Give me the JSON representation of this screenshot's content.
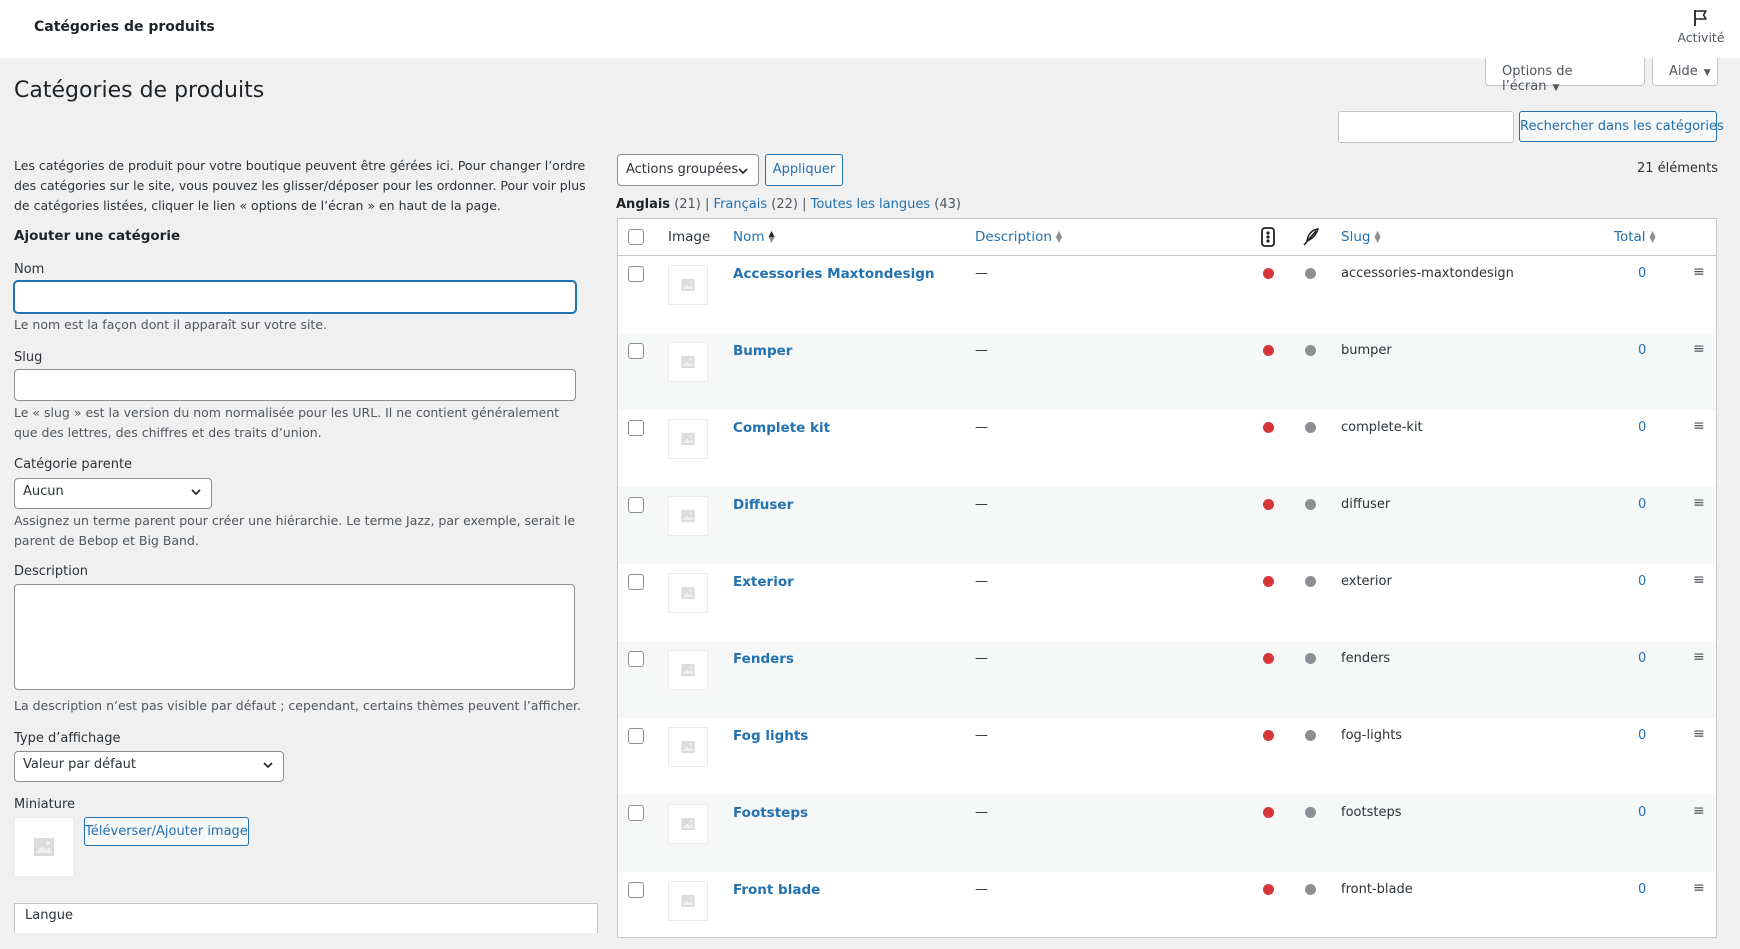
{
  "topbar": {
    "title": "Catégories de produits",
    "activity_label": "Activité"
  },
  "screen_meta": {
    "options_label": "Options de l’écran",
    "help_label": "Aide"
  },
  "page": {
    "title": "Catégories de produits"
  },
  "search": {
    "value": "",
    "button_label": "Rechercher dans les catégories"
  },
  "form": {
    "intro": "Les catégories de produit pour votre boutique peuvent être gérées ici. Pour changer l’ordre des catégories sur le site, vous pouvez les glisser/déposer pour les ordonner. Pour voir plus de catégories listées, cliquer le lien « options de l’écran » en haut de la page.",
    "heading": "Ajouter une catégorie",
    "name_label": "Nom",
    "name_value": "",
    "name_help": "Le nom est la façon dont il apparaît sur votre site.",
    "slug_label": "Slug",
    "slug_value": "",
    "slug_help": "Le « slug » est la version du nom normalisée pour les URL. Il ne contient généralement que des lettres, des chiffres et des traits d’union.",
    "parent_label": "Catégorie parente",
    "parent_value": "Aucun",
    "parent_help": "Assignez un terme parent pour créer une hiérarchie. Le terme Jazz, par exemple, serait le parent de Bebop et Big Band.",
    "description_label": "Description",
    "description_value": "",
    "description_help": "La description n’est pas visible par défaut ; cependant, certains thèmes peuvent l’afficher.",
    "display_type_label": "Type d’affichage",
    "display_type_value": "Valeur par défaut",
    "thumbnail_label": "Miniature",
    "upload_button": "Téléverser/Ajouter image",
    "language_label": "Langue"
  },
  "list": {
    "bulk_actions": "Actions groupées",
    "apply": "Appliquer",
    "count": "21 éléments",
    "filters": [
      {
        "label": "Anglais",
        "count": "(21)",
        "current": true
      },
      {
        "label": "Français",
        "count": "(22)",
        "current": false
      },
      {
        "label": "Toutes les langues",
        "count": "(43)",
        "current": false
      }
    ],
    "columns": {
      "image": "Image",
      "name": "Nom",
      "description": "Description",
      "slug": "Slug",
      "total": "Total"
    },
    "rows": [
      {
        "name": "Accessories Maxtondesign",
        "description": "—",
        "slug": "accessories-maxtondesign",
        "total": "0"
      },
      {
        "name": "Bumper",
        "description": "—",
        "slug": "bumper",
        "total": "0"
      },
      {
        "name": "Complete kit",
        "description": "—",
        "slug": "complete-kit",
        "total": "0"
      },
      {
        "name": "Diffuser",
        "description": "—",
        "slug": "diffuser",
        "total": "0"
      },
      {
        "name": "Exterior",
        "description": "—",
        "slug": "exterior",
        "total": "0"
      },
      {
        "name": "Fenders",
        "description": "—",
        "slug": "fenders",
        "total": "0"
      },
      {
        "name": "Fog lights",
        "description": "—",
        "slug": "fog-lights",
        "total": "0"
      },
      {
        "name": "Footsteps",
        "description": "—",
        "slug": "footsteps",
        "total": "0"
      },
      {
        "name": "Front blade",
        "description": "—",
        "slug": "front-blade",
        "total": "0"
      }
    ]
  },
  "colors": {
    "link": "#2271b1",
    "status_red": "#d63638",
    "status_grey": "#8c8f94"
  }
}
